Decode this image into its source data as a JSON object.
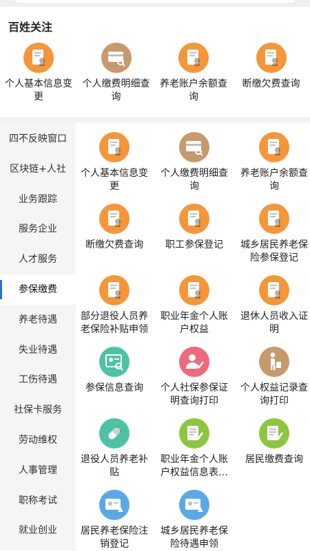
{
  "header": {
    "section_title": "百姓关注"
  },
  "top_services": [
    {
      "label": "个人基本信息变更",
      "icon": "person-doc-icon",
      "color": "#f5963a"
    },
    {
      "label": "个人缴费明细查询",
      "icon": "card-search-icon",
      "color": "#c79a6b"
    },
    {
      "label": "养老账户余额查询",
      "icon": "person-doc-icon",
      "color": "#f5963a"
    },
    {
      "label": "断缴欠费查询",
      "icon": "person-doc-icon",
      "color": "#f5963a"
    }
  ],
  "sidebar": {
    "items": [
      {
        "label": "四不反映窗口"
      },
      {
        "label": "区块链+人社"
      },
      {
        "label": "业务跟踪"
      },
      {
        "label": "服务企业"
      },
      {
        "label": "人才服务"
      },
      {
        "label": "参保缴费",
        "active": true
      },
      {
        "label": "养老待遇"
      },
      {
        "label": "失业待遇"
      },
      {
        "label": "工伤待遇"
      },
      {
        "label": "社保卡服务"
      },
      {
        "label": "劳动维权"
      },
      {
        "label": "人事管理"
      },
      {
        "label": "职称考试"
      },
      {
        "label": "就业创业"
      }
    ]
  },
  "services": [
    {
      "label": "个人基本信息变更",
      "icon": "person-doc-icon",
      "color": "#f5963a"
    },
    {
      "label": "个人缴费明细查询",
      "icon": "card-search-icon",
      "color": "#c79a6b"
    },
    {
      "label": "养老账户余额查询",
      "icon": "person-doc-icon",
      "color": "#f5963a"
    },
    {
      "label": "断缴欠费查询",
      "icon": "person-doc-icon",
      "color": "#f5963a"
    },
    {
      "label": "职工参保登记",
      "icon": "person-doc-icon",
      "color": "#f5963a"
    },
    {
      "label": "城乡居民养老保险参保登记",
      "icon": "person-doc-icon",
      "color": "#f5963a"
    },
    {
      "label": "部分退役人员养老保险补贴申领",
      "icon": "person-doc-icon",
      "color": "#f5963a"
    },
    {
      "label": "职业年金个人账户权益",
      "icon": "person-doc-icon",
      "color": "#f5963a"
    },
    {
      "label": "退休人员收入证明",
      "icon": "person-doc-icon",
      "color": "#f5963a"
    },
    {
      "label": "参保信息查询",
      "icon": "id-card-search-icon",
      "color": "#4fc2a6"
    },
    {
      "label": "个人社保参保证明查询打印",
      "icon": "person-check-icon",
      "color": "#ec6a7a"
    },
    {
      "label": "个人权益记录查询打印",
      "icon": "person-luggage-icon",
      "color": "#c79a6b"
    },
    {
      "label": "退役人员养老补贴",
      "icon": "pill-icon",
      "color": "#4fc2a6"
    },
    {
      "label": "职业年金个人账户权益信息表…",
      "icon": "form-edit-icon",
      "color": "#8cc63f"
    },
    {
      "label": "居民缴费查询",
      "icon": "form-edit-icon",
      "color": "#8cc63f"
    },
    {
      "label": "居民养老保险注销登记",
      "icon": "card-person-icon",
      "color": "#5aa9e6"
    },
    {
      "label": "城乡居民养老保险待遇申领",
      "icon": "card-person-icon",
      "color": "#5aa9e6"
    }
  ]
}
